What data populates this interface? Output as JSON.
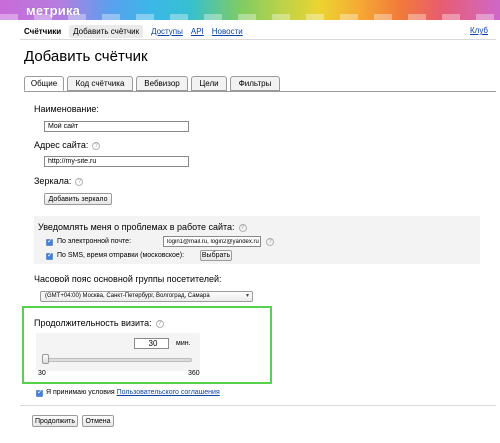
{
  "header": {
    "logo_text": "метрика"
  },
  "nav": {
    "items": [
      {
        "label": "Счётчики",
        "style": "current"
      },
      {
        "label": "Добавить счётчик",
        "style": "pill"
      },
      {
        "label": "Доступы",
        "style": "link"
      },
      {
        "label": "API",
        "style": "link"
      },
      {
        "label": "Новости",
        "style": "link"
      }
    ],
    "club": "Клуб"
  },
  "page_title": "Добавить счётчик",
  "tabs": [
    {
      "label": "Общие",
      "active": true
    },
    {
      "label": "Код счётчика",
      "active": false
    },
    {
      "label": "Вебвизор",
      "active": false
    },
    {
      "label": "Цели",
      "active": false
    },
    {
      "label": "Фильтры",
      "active": false
    }
  ],
  "form": {
    "name_label": "Наименование:",
    "name_value": "Мой сайт",
    "site_label": "Адрес сайта:",
    "site_value": "http://my-site.ru",
    "mirrors_label": "Зеркала:",
    "add_mirror_button": "Добавить зеркало",
    "notify_label": "Уведомлять меня о проблемах в работе сайта:",
    "email_option": "По электронной почте:",
    "email_value": "login1@mail.ru, login2@yandex.ru",
    "sms_option": "По SMS, время отправки (московское):",
    "choose_button": "Выбрать",
    "timezone_label": "Часовой пояс основной группы посетителей:",
    "timezone_value": "(GMT+04:00) Москва, Санкт-Петербург, Волгоград, Самара",
    "duration_label": "Продолжительность визита:",
    "duration_value": "30",
    "duration_unit": "мин.",
    "slider_min": "30",
    "slider_max": "360",
    "slider_value": 30,
    "accept_prefix": "Я принимаю условия",
    "accept_link": "Пользовательского соглашения",
    "continue_button": "Продолжить",
    "cancel_button": "Отмена"
  },
  "colors": {
    "highlight": "#56d24d",
    "link": "#0b44a8"
  }
}
